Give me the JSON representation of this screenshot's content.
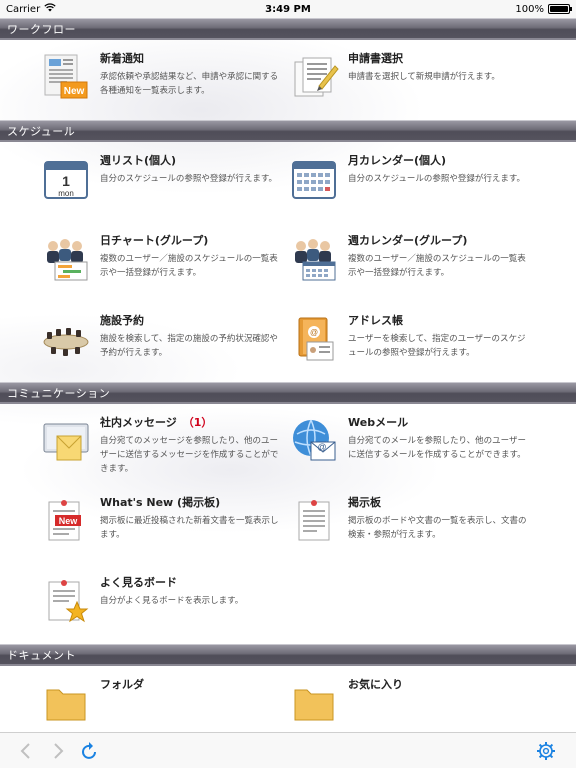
{
  "status_bar": {
    "carrier": "Carrier",
    "wifi_icon": "wifi-icon",
    "time": "3:49 PM",
    "battery_percent": "100%",
    "battery_level": 1.0
  },
  "sections": {
    "workflow": {
      "title": "ワークフロー",
      "items": [
        {
          "title": "新着通知",
          "desc": "承認依頼や承認結果など、申請や承認に関する各種通知を一覧表示します。",
          "icon": "new-notice-icon"
        },
        {
          "title": "申請書選択",
          "desc": "申請書を選択して新規申請が行えます。",
          "icon": "application-form-icon"
        }
      ]
    },
    "schedule": {
      "title": "スケジュール",
      "items": [
        {
          "title": "週リスト(個人)",
          "desc": "自分のスケジュールの参照や登録が行えます。",
          "icon": "calendar-day-icon",
          "icon_text": "1",
          "icon_sub": "mon"
        },
        {
          "title": "月カレンダー(個人)",
          "desc": "自分のスケジュールの参照や登録が行えます。",
          "icon": "month-calendar-icon"
        },
        {
          "title": "日チャート(グループ)",
          "desc": "複数のユーザー／施設のスケジュールの一覧表示や一括登録が行えます。",
          "icon": "group-chart-icon"
        },
        {
          "title": "週カレンダー(グループ)",
          "desc": "複数のユーザー／施設のスケジュールの一覧表示や一括登録が行えます。",
          "icon": "group-calendar-icon"
        },
        {
          "title": "施設予約",
          "desc": "施設を検索して、指定の施設の予約状況確認や予約が行えます。",
          "icon": "meeting-room-icon"
        },
        {
          "title": "アドレス帳",
          "desc": "ユーザーを検索して、指定のユーザーのスケジュールの参照や登録が行えます。",
          "icon": "address-book-icon"
        }
      ]
    },
    "communication": {
      "title": "コミュニケーション",
      "items": [
        {
          "title": "社内メッセージ",
          "badge": "（1）",
          "desc": "自分宛てのメッセージを参照したり、他のユーザーに送信するメッセージを作成することができます。",
          "icon": "message-icon"
        },
        {
          "title": "Webメール",
          "desc": "自分宛てのメールを参照したり、他のユーザーに送信するメールを作成することができます。",
          "icon": "webmail-icon"
        },
        {
          "title": "What's New (掲示板)",
          "desc": "掲示板に最近投稿された新着文書を一覧表示します。",
          "icon": "whats-new-icon"
        },
        {
          "title": "掲示板",
          "desc": "掲示板のボードや文書の一覧を表示し、文書の検索・参照が行えます。",
          "icon": "bulletin-board-icon"
        },
        {
          "title": "よく見るボード",
          "desc": "自分がよく見るボードを表示します。",
          "icon": "favorite-board-icon"
        }
      ]
    },
    "document": {
      "title": "ドキュメント",
      "items": [
        {
          "title": "フォルダ",
          "icon": "folder-icon"
        },
        {
          "title": "お気に入り",
          "icon": "favorite-folder-icon"
        }
      ]
    }
  },
  "icon_text": {
    "new_badge": "New"
  },
  "toolbar": {
    "back_icon": "chevron-left-icon",
    "forward_icon": "chevron-right-icon",
    "reload_icon": "reload-icon",
    "settings_icon": "gear-icon"
  },
  "colors": {
    "section_header": "#5f5d68",
    "badge": "#d0021b",
    "toolbar_tint": "#1a82e2",
    "toolbar_disabled": "#c0c0c0"
  }
}
